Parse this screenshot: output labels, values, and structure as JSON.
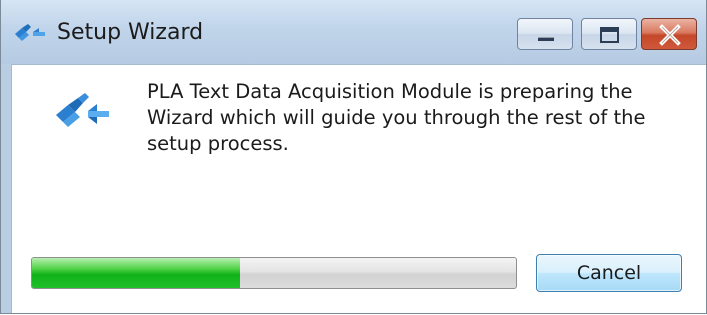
{
  "window": {
    "title": "Setup Wizard",
    "icon": "app-logo-icon",
    "controls": {
      "minimize": "minimize-icon",
      "maximize": "maximize-icon",
      "close": "close-icon"
    }
  },
  "content": {
    "message": "PLA Text Data Acquisition Module is preparing the Wizard which will guide you through the rest of the setup process.",
    "icon": "app-logo-icon"
  },
  "progress": {
    "fraction": 0.43,
    "color": "#1fbf2a"
  },
  "buttons": {
    "cancel_label": "Cancel"
  },
  "colors": {
    "logo_blue": "#2a7fd0",
    "titlebar": "#c0d4ea",
    "close_button": "#c4482a"
  }
}
